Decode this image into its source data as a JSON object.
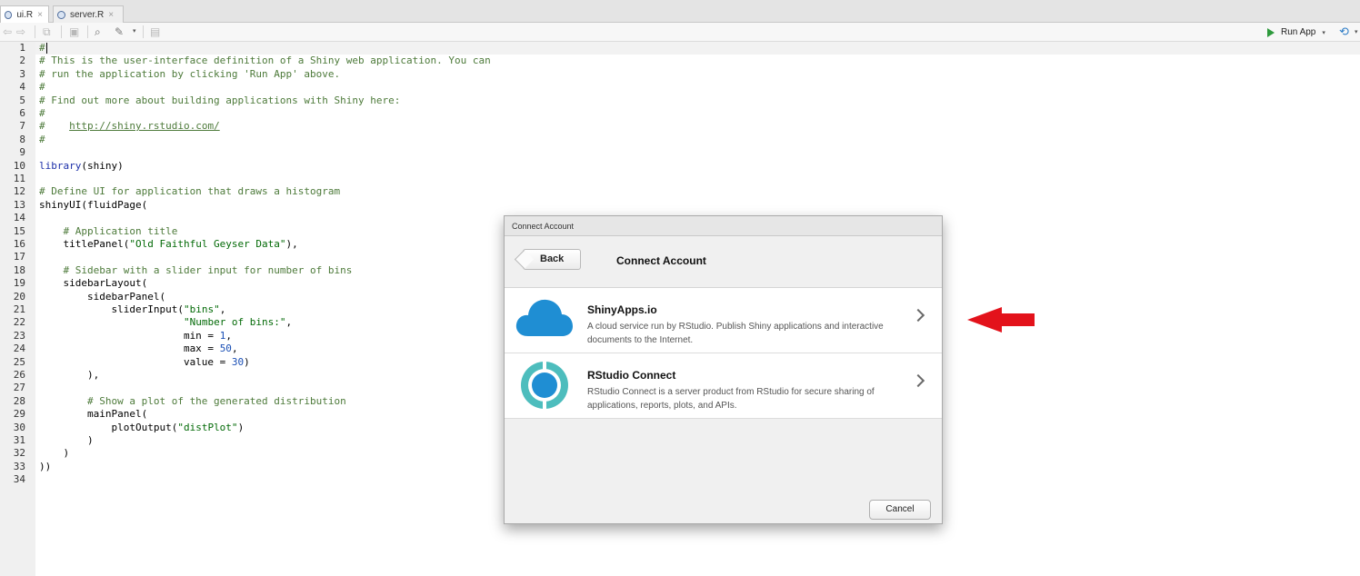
{
  "tabs": [
    {
      "label": "ui.R",
      "active": true
    },
    {
      "label": "server.R",
      "active": false
    }
  ],
  "toolbar": {
    "run_app_label": "Run App",
    "icons": [
      "back-arrow-icon",
      "forward-arrow-icon",
      "show-in-window-icon",
      "save-icon",
      "search-icon",
      "code-tools-wand-icon",
      "compile-report-icon"
    ]
  },
  "editor": {
    "line_numbers": [
      "1",
      "2",
      "3",
      "4",
      "5",
      "6",
      "7",
      "8",
      "9",
      "10",
      "11",
      "12",
      "13",
      "14",
      "15",
      "16",
      "17",
      "18",
      "19",
      "20",
      "21",
      "22",
      "23",
      "24",
      "25",
      "26",
      "27",
      "28",
      "29",
      "30",
      "31",
      "32",
      "33",
      "34"
    ],
    "lines": {
      "l1": "#",
      "l2": "# This is the user-interface definition of a Shiny web application. You can",
      "l3": "# run the application by clicking 'Run App' above.",
      "l4": "#",
      "l5": "# Find out more about building applications with Shiny here:",
      "l6": "#",
      "l7_prefix": "#    ",
      "l7_url": "http://shiny.rstudio.com/",
      "l8": "#",
      "l10_fn": "library",
      "l10_rest": "(shiny)",
      "l12": "# Define UI for application that draws a histogram",
      "l13": "shinyUI(fluidPage(",
      "l15": "    # Application title",
      "l16_a": "    titlePanel(",
      "l16_s": "\"Old Faithful Geyser Data\"",
      "l16_b": "),",
      "l18": "    # Sidebar with a slider input for number of bins",
      "l19": "    sidebarLayout(",
      "l20": "        sidebarPanel(",
      "l21_a": "            sliderInput(",
      "l21_s": "\"bins\"",
      "l21_b": ",",
      "l22_a": "                        ",
      "l22_s": "\"Number of bins:\"",
      "l22_b": ",",
      "l23_a": "                        min = ",
      "l23_n": "1",
      "l23_b": ",",
      "l24_a": "                        max = ",
      "l24_n": "50",
      "l24_b": ",",
      "l25_a": "                        value = ",
      "l25_n": "30",
      "l25_b": ")",
      "l26": "        ),",
      "l28": "        # Show a plot of the generated distribution",
      "l29": "        mainPanel(",
      "l30_a": "            plotOutput(",
      "l30_s": "\"distPlot\"",
      "l30_b": ")",
      "l31": "        )",
      "l32": "    )",
      "l33": "))"
    }
  },
  "dialog": {
    "window_title": "Connect Account",
    "heading": "Connect Account",
    "back_label": "Back",
    "services": [
      {
        "name": "ShinyApps.io",
        "description": "A cloud service run by RStudio. Publish Shiny applications and interactive documents to the Internet.",
        "icon": "cloud-icon"
      },
      {
        "name": "RStudio Connect",
        "description": "RStudio Connect is a server product from RStudio for secure sharing of applications, reports, plots, and APIs.",
        "icon": "rstudio-connect-icon"
      }
    ],
    "cancel_label": "Cancel"
  },
  "colors": {
    "annotation_arrow": "#e3121b",
    "cloud": "#1f8ed3",
    "connect_ring": "#4dbdbd"
  }
}
